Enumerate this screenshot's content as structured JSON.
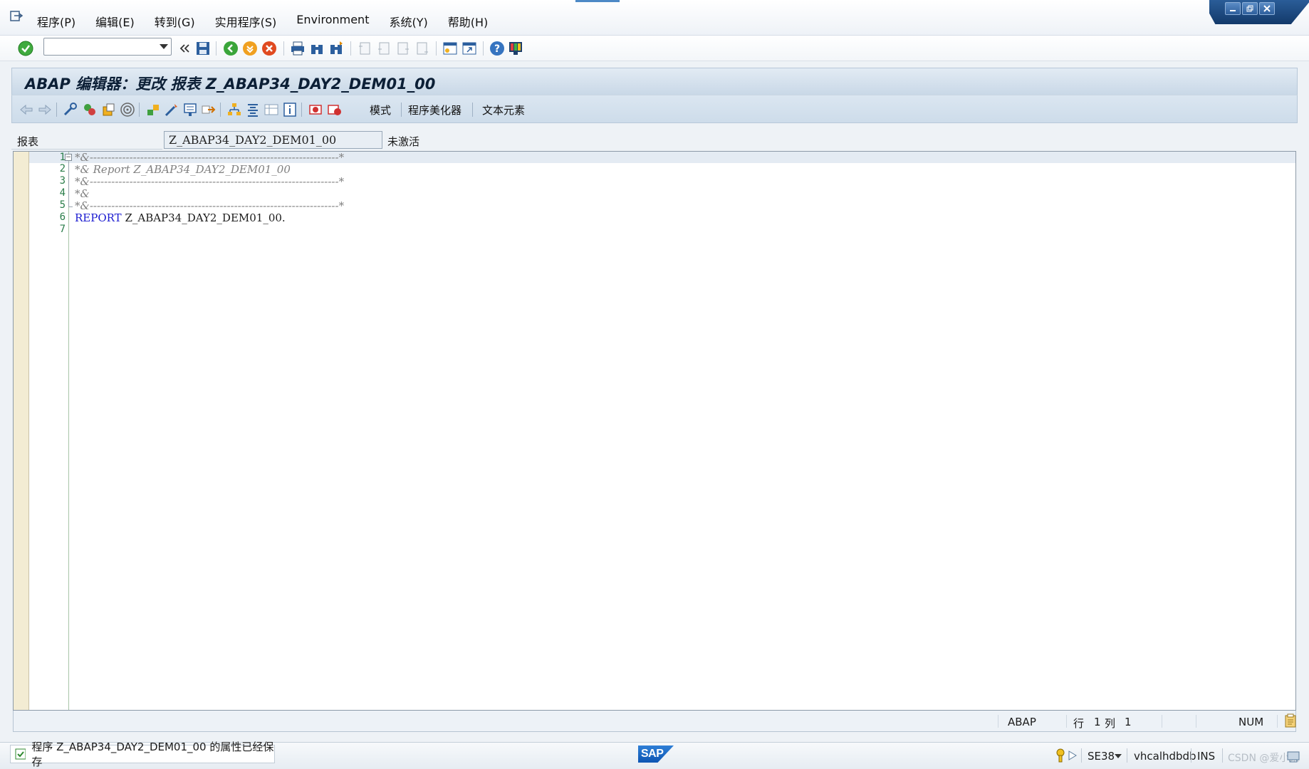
{
  "menu": {
    "items": [
      "程序(P)",
      "编辑(E)",
      "转到(G)",
      "实用程序(S)",
      "Environment",
      "系统(Y)",
      "帮助(H)"
    ]
  },
  "title": "ABAP 编辑器：更改 报表 Z_ABAP34_DAY2_DEM01_00",
  "app_toolbar": {
    "pattern_label": "模式",
    "pretty_printer_label": "程序美化器",
    "text_elements_label": "文本元素"
  },
  "report_field": {
    "label": "报表",
    "value": "Z_ABAP34_DAY2_DEM01_00",
    "status": "未激活"
  },
  "editor": {
    "line_numbers": [
      "1",
      "2",
      "3",
      "4",
      "5",
      "6",
      "7"
    ],
    "code": {
      "line1": "*&---------------------------------------------------------------------*",
      "line2": "*& Report Z_ABAP34_DAY2_DEM01_00",
      "line3": "*&---------------------------------------------------------------------*",
      "line4": "*&",
      "line5": "*&---------------------------------------------------------------------*",
      "line6_keyword": "REPORT",
      "line6_rest": " Z_ABAP34_DAY2_DEM01_00."
    },
    "status": {
      "language": "ABAP",
      "row_label": "行",
      "row_value": "1",
      "col_label": "列",
      "col_value": "1",
      "num": "NUM"
    }
  },
  "status_bar": {
    "message": "程序 Z_ABAP34_DAY2_DEM01_00 的属性已经保存",
    "logo_text": "SAP",
    "transaction": "SE38",
    "server": "vhcalhdbdb",
    "mode": "INS",
    "watermark": "CSDN @爱小菜"
  },
  "colors": {
    "keyword": "#1a1ad0",
    "comment": "#808080",
    "accent": "#4d89c6"
  }
}
